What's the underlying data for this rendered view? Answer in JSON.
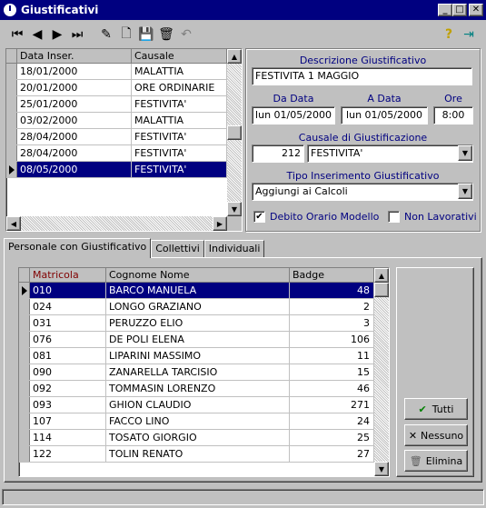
{
  "window": {
    "title": "Giustificativi",
    "min": "_",
    "max": "□",
    "close": "✕"
  },
  "toolbar": {
    "first": "⏮",
    "prev": "◀",
    "next": "▶",
    "last": "⏭",
    "edit": "✎",
    "new": "🗋",
    "save": "💾",
    "delete": "🗑",
    "undo": "↶",
    "help": "?",
    "exit": "⇥"
  },
  "top_grid": {
    "headers": [
      "Data Inser.",
      "Causale"
    ],
    "rows": [
      {
        "date": "18/01/2000",
        "causale": "MALATTIA"
      },
      {
        "date": "20/01/2000",
        "causale": "ORE ORDINARIE"
      },
      {
        "date": "25/01/2000",
        "causale": "FESTIVITA'"
      },
      {
        "date": "03/02/2000",
        "causale": "MALATTIA"
      },
      {
        "date": "28/04/2000",
        "causale": "FESTIVITA'"
      },
      {
        "date": "28/04/2000",
        "causale": "FESTIVITA'"
      },
      {
        "date": "08/05/2000",
        "causale": "FESTIVITA'"
      }
    ],
    "selected_row": 6
  },
  "form": {
    "descrizione_label": "Descrizione Giustificativo",
    "descrizione_value": "FESTIVITA 1 MAGGIO",
    "da_data_label": "Da Data",
    "da_data_value": "lun 01/05/2000",
    "a_data_label": "A Data",
    "a_data_value": "lun 01/05/2000",
    "ore_label": "Ore",
    "ore_value": "8:00",
    "causale_label": "Causale di Giustificazione",
    "causale_code": "212",
    "causale_value": "FESTIVITA'",
    "tipo_label": "Tipo Inserimento Giustificativo",
    "tipo_value": "Aggiungi ai Calcoli",
    "debito_label": "Debito Orario Modello",
    "debito_checked": true,
    "nonlav_label": "Non Lavorativi",
    "nonlav_checked": false
  },
  "tabs": [
    "Personale con Giustificativo",
    "Collettivi",
    "Individuali"
  ],
  "active_tab": 0,
  "people_grid": {
    "headers": [
      "Matricola",
      "Cognome Nome",
      "Badge"
    ],
    "rows": [
      {
        "matricola": "010",
        "nome": "BARCO MANUELA",
        "badge": "48"
      },
      {
        "matricola": "024",
        "nome": "LONGO GRAZIANO",
        "badge": "2"
      },
      {
        "matricola": "031",
        "nome": "PERUZZO ELIO",
        "badge": "3"
      },
      {
        "matricola": "076",
        "nome": "DE POLI ELENA",
        "badge": "106"
      },
      {
        "matricola": "081",
        "nome": "LIPARINI MASSIMO",
        "badge": "11"
      },
      {
        "matricola": "090",
        "nome": "ZANARELLA TARCISIO",
        "badge": "15"
      },
      {
        "matricola": "092",
        "nome": "TOMMASIN LORENZO",
        "badge": "46"
      },
      {
        "matricola": "093",
        "nome": "GHION CLAUDIO",
        "badge": "271"
      },
      {
        "matricola": "107",
        "nome": "FACCO LINO",
        "badge": "24"
      },
      {
        "matricola": "114",
        "nome": "TOSATO GIORGIO",
        "badge": "25"
      },
      {
        "matricola": "122",
        "nome": "TOLIN RENATO",
        "badge": "27"
      }
    ],
    "selected_row": 0
  },
  "buttons": {
    "tutti": "Tutti",
    "nessuno": "Nessuno",
    "elimina": "Elimina"
  },
  "colors": {
    "title_bar": "#000080",
    "selection": "#000080",
    "label": "#000080",
    "matricola_header": "#800000"
  }
}
